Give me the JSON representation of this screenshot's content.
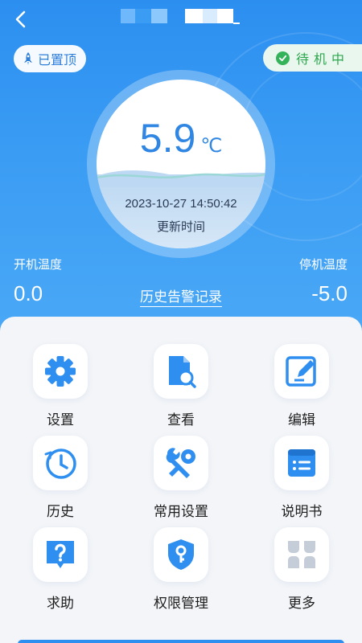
{
  "header": {
    "title_masked": true,
    "back_icon": "chevron-left-icon",
    "pin_label": "已置顶",
    "pin_icon": "rocket-icon",
    "status_label": "待机中",
    "status_icon": "check-circle-icon"
  },
  "gauge": {
    "temperature": "5.9",
    "unit": "℃",
    "updated_at": "2023-10-27 14:50:42",
    "updated_label": "更新时间"
  },
  "thresholds": {
    "start_label": "开机温度",
    "start_value": "0.0",
    "stop_label": "停机温度",
    "stop_value": "-5.0"
  },
  "history_link": "历史告警记录",
  "menu": [
    {
      "label": "设置",
      "icon": "gear-icon"
    },
    {
      "label": "查看",
      "icon": "document-search-icon"
    },
    {
      "label": "编辑",
      "icon": "edit-icon"
    },
    {
      "label": "历史",
      "icon": "clock-icon"
    },
    {
      "label": "常用设置",
      "icon": "tools-icon"
    },
    {
      "label": "说明书",
      "icon": "manual-icon"
    },
    {
      "label": "求助",
      "icon": "help-icon"
    },
    {
      "label": "权限管理",
      "icon": "key-shield-icon"
    },
    {
      "label": "更多",
      "icon": "more-grid-icon"
    }
  ],
  "colors": {
    "primary": "#2f8ff0",
    "status_green": "#35b35a",
    "text_dark": "#1e1e1e"
  }
}
